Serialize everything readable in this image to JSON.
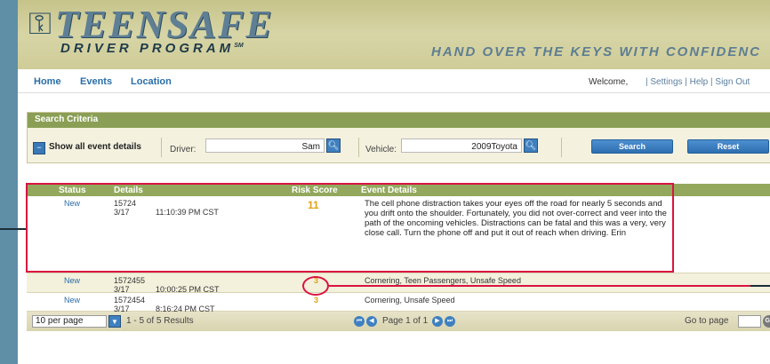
{
  "brand": {
    "title": "TEENSAFE",
    "subtitle": "DRIVER PROGRAM",
    "trademark": "SM",
    "tagline": "HAND OVER THE KEYS WITH CONFIDENC"
  },
  "nav": {
    "home": "Home",
    "events": "Events",
    "location": "Location",
    "welcome": "Welcome,",
    "settings": "| Settings",
    "help": "| Help",
    "signout": "| Sign Out"
  },
  "search": {
    "heading": "Search Criteria",
    "show_all": "Show all event details",
    "driver_label": "Driver:",
    "driver_value": "Sam",
    "vehicle_label": "Vehicle:",
    "vehicle_value": "2009Toyota",
    "search_button": "Search",
    "reset_button": "Reset"
  },
  "table": {
    "headers": {
      "status": "Status",
      "details": "Details",
      "risk": "Risk Score",
      "event": "Event Details"
    },
    "rows": [
      {
        "status": "New",
        "id": "15724",
        "date": "3/17",
        "time": "11:10:39 PM CST",
        "risk": "11",
        "event": "The cell phone distraction takes your eyes off the road for nearly 5 seconds and you drift onto the shoulder.  Fortunately, you did not over-correct and veer into the path of the oncoming vehicles. Distractions can be fatal and this was a very, very close call.  Turn the phone off and put it out of reach when driving.  Erin"
      },
      {
        "status": "New",
        "id": "1572455",
        "date": "3/17",
        "time": "10:00:25 PM CST",
        "risk": "3",
        "event": "Cornering, Teen Passengers, Unsafe Speed"
      },
      {
        "status": "New",
        "id": "1572454",
        "date": "3/17",
        "time": "8:16:24 PM CST",
        "risk": "3",
        "event": "Cornering, Unsafe Speed"
      }
    ]
  },
  "footer": {
    "per_page": "10 per page",
    "results": "1 - 5 of 5 Results",
    "page_info": "Page 1 of 1",
    "goto_label": "Go to page",
    "go_button": "GO"
  },
  "colors": {
    "header_bg": "#cfcc98",
    "table_head": "#93a85d",
    "link": "#2a6ea8",
    "accent_blue": "#3f80c0",
    "risk": "#e0a21a",
    "highlight": "#d9143f"
  }
}
